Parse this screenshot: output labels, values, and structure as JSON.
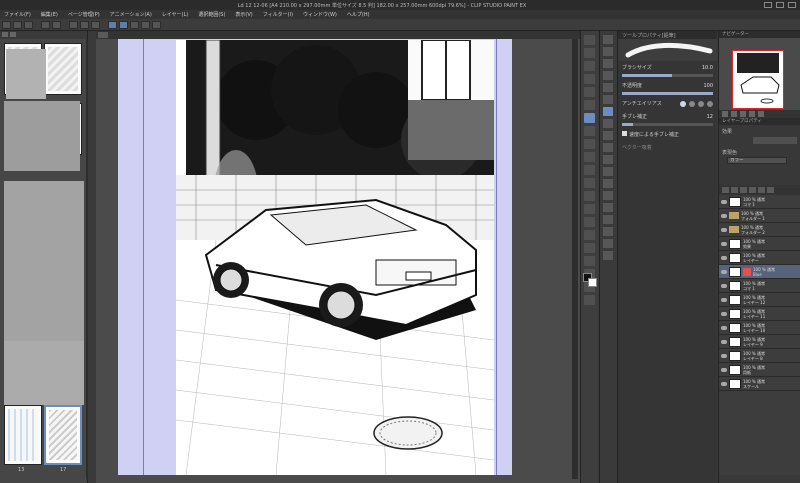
{
  "title_bar": {
    "text": "Ld 12 12-06 [A4 210.00 x 297.00mm 単位サイズ 8.5 判] 182.00 x 257.00mm 600dpi 79.6%] - CLIP STUDIO PAINT EX"
  },
  "menu": [
    "ファイル(F)",
    "編集(E)",
    "ページ管理(P)",
    "アニメーション(A)",
    "レイヤー(L)",
    "選択範囲(S)",
    "表示(V)",
    "フィルター(I)",
    "ウィンドウ(W)",
    "ヘルプ(H)"
  ],
  "page_panel": {
    "thumbnails": [
      {
        "label": "",
        "number": ""
      },
      {
        "label": "",
        "number": ""
      },
      {
        "label": "13",
        "number": "13"
      },
      {
        "label": "17",
        "number": "17"
      }
    ]
  },
  "canvas": {
    "tab_label": "",
    "zoom": "79.6%"
  },
  "tool_property": {
    "header": "ツールプロパティ[鉛筆]",
    "brush_label": "Gペン",
    "brush_size_label": "ブラシサイズ",
    "brush_size_value": "10.0",
    "opacity_label": "不透明度",
    "opacity_value": "100",
    "aa_label": "アンチエイリアス",
    "stabilization_label": "手ブレ補正",
    "stabilization_value": "12",
    "speed_stabilization_label": "速度による手ブレ補正",
    "vector_label": "ベクター吸着"
  },
  "navigator": {
    "header": "ナビゲーター",
    "zoom_text": "79.6"
  },
  "layer_property": {
    "header": "レイヤープロパティ",
    "effect_label": "効果",
    "color_label": "表現色",
    "color_value": "カラー",
    "blend_label": "レイヤー"
  },
  "layers": [
    {
      "name": "100 % 通常",
      "sub": "コマ 1",
      "kind": "layer"
    },
    {
      "name": "100 % 通常",
      "sub": "フォルダー 1",
      "kind": "folder"
    },
    {
      "name": "100 % 通常",
      "sub": "フォルダー 2",
      "kind": "folder"
    },
    {
      "name": "100 % 通常",
      "sub": "効果",
      "kind": "layer"
    },
    {
      "name": "100 % 通常",
      "sub": "レイヤー",
      "kind": "layer"
    },
    {
      "name": "100 % 通常",
      "sub": "Blue",
      "kind": "mask",
      "selected": true
    },
    {
      "name": "100 % 通常",
      "sub": "コマ 1",
      "kind": "layer"
    },
    {
      "name": "100 % 通常",
      "sub": "レイヤー 12",
      "kind": "layer"
    },
    {
      "name": "100 % 通常",
      "sub": "レイヤー 11",
      "kind": "layer"
    },
    {
      "name": "100 % 通常",
      "sub": "レイヤー 10",
      "kind": "layer"
    },
    {
      "name": "100 % 通常",
      "sub": "レイヤー 9",
      "kind": "layer"
    },
    {
      "name": "100 % 通常",
      "sub": "レイヤー 8",
      "kind": "layer"
    },
    {
      "name": "100 % 通常",
      "sub": "用紙",
      "kind": "layer"
    },
    {
      "name": "100 % 通常",
      "sub": "スケール",
      "kind": "layer"
    }
  ],
  "colors": {
    "bleed": "#cfd0f3",
    "selection_frame": "#e0262b",
    "active_tool": "#6d8cc0"
  }
}
